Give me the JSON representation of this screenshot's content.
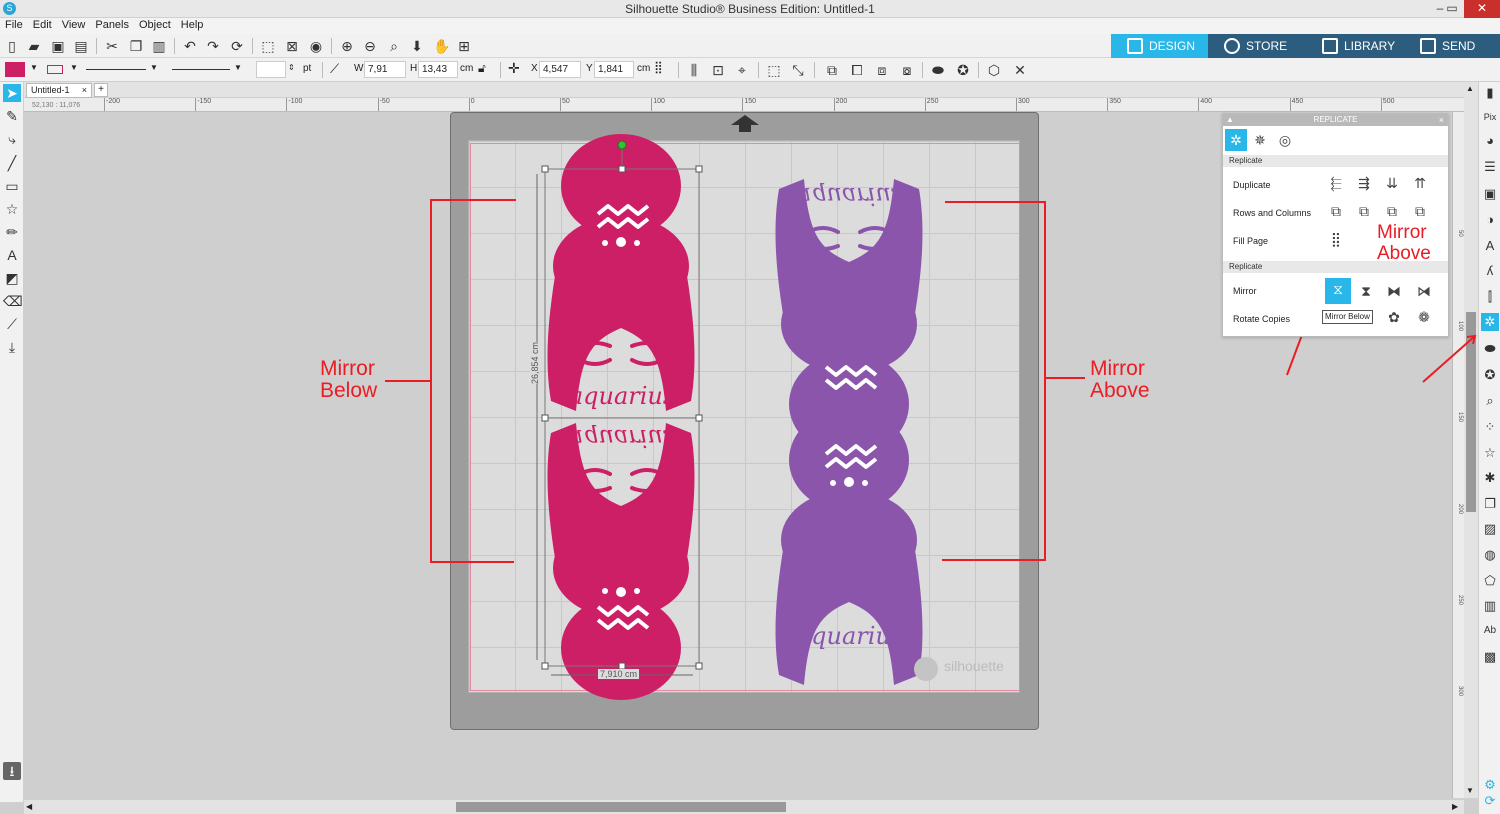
{
  "window": {
    "title": "Silhouette Studio® Business Edition: Untitled-1",
    "minimize": "–",
    "restore": "▭",
    "close": "✕"
  },
  "menu": [
    "File",
    "Edit",
    "View",
    "Panels",
    "Object",
    "Help"
  ],
  "nav_tabs": [
    {
      "label": "DESIGN"
    },
    {
      "label": "STORE"
    },
    {
      "label": "LIBRARY"
    },
    {
      "label": "SEND"
    }
  ],
  "colors": {
    "accent": "#29b6e8",
    "nav_dark": "#2d5d7e",
    "pink_design": "#cc1f66",
    "purple_design": "#8a55aa",
    "annotation": "#ea1d24"
  },
  "toolbar2": {
    "line_weight_unit": "pt",
    "w_label": "W",
    "w_value": "7,91",
    "h_label": "H",
    "h_value": "13,43",
    "size_unit": "cm",
    "x_label": "X",
    "x_value": "4,547",
    "y_label": "Y",
    "y_value": "1,841",
    "pos_unit": "cm"
  },
  "document_tab": {
    "name": "Untitled-1",
    "close": "×",
    "add": "+"
  },
  "coords_readout": "52,130 : 11,076",
  "ruler_h_ticks": [
    "-200",
    "-150",
    "-100",
    "-50",
    "0",
    "50",
    "100",
    "150",
    "200",
    "250",
    "300",
    "350",
    "400",
    "450",
    "500"
  ],
  "ruler_v_ticks": [
    "50",
    "100",
    "150",
    "200",
    "250",
    "300"
  ],
  "design": {
    "word": "aquarius",
    "height_dim": "26,854 cm",
    "width_dim": "7,910 cm",
    "watermark": "silhouette"
  },
  "replicate_panel": {
    "title": "REPLICATE",
    "section1": "Replicate",
    "rows1": [
      "Duplicate",
      "Rows and Columns",
      "Fill Page"
    ],
    "section2": "Replicate",
    "rows2": [
      "Mirror",
      "Rotate Copies"
    ],
    "tooltip": "Mirror Below"
  },
  "annotations": {
    "left": [
      "Mirror",
      "Below"
    ],
    "right": [
      "Mirror",
      "Above"
    ],
    "panel": [
      "Mirror",
      "Above"
    ]
  }
}
